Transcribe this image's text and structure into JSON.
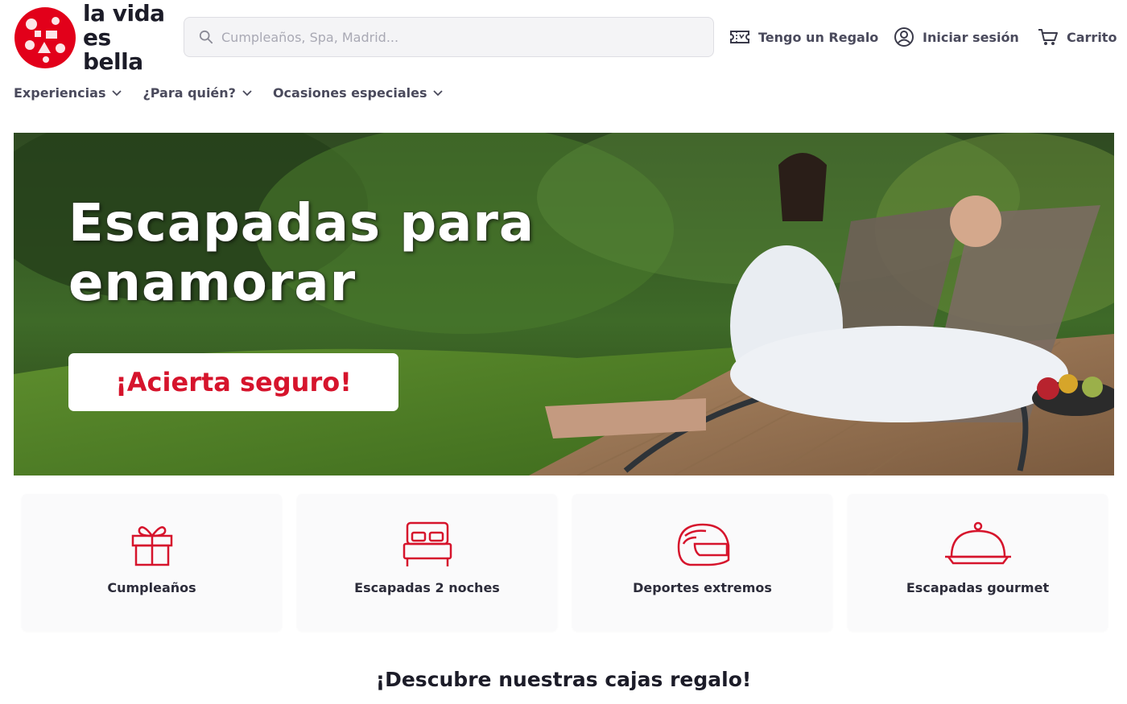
{
  "brand": {
    "name_line1": "la vida",
    "name_line2": "es bella",
    "accent": "#d6142c"
  },
  "search": {
    "placeholder": "Cumpleaños, Spa, Madrid...",
    "value": ""
  },
  "header_links": {
    "gift_card": "Tengo un Regalo",
    "login": "Iniciar sesión",
    "cart": "Carrito"
  },
  "nav": {
    "items": [
      {
        "label": "Experiencias"
      },
      {
        "label": "¿Para quién?"
      },
      {
        "label": "Ocasiones especiales"
      }
    ]
  },
  "hero": {
    "title": "Escapadas para enamorar",
    "cta": "¡Acierta seguro!"
  },
  "categories": [
    {
      "label": "Cumpleaños",
      "icon": "gift-icon"
    },
    {
      "label": "Escapadas 2 noches",
      "icon": "bed-icon"
    },
    {
      "label": "Deportes extremos",
      "icon": "helmet-icon"
    },
    {
      "label": "Escapadas gourmet",
      "icon": "cloche-icon"
    }
  ],
  "section": {
    "title": "¡Descubre nuestras cajas regalo!"
  }
}
